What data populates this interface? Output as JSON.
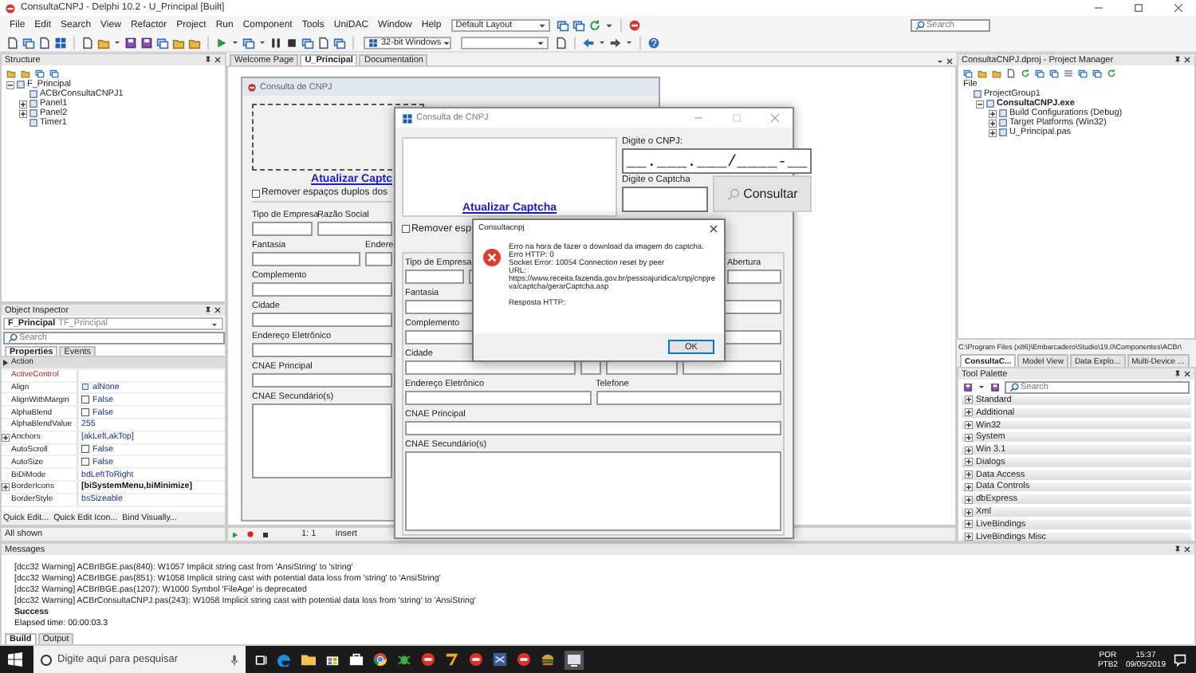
{
  "ide": {
    "title": "ConsultaCNPJ - Delphi 10.2 - U_Principal [Built]",
    "menus": [
      "File",
      "Edit",
      "Search",
      "View",
      "Refactor",
      "Project",
      "Run",
      "Component",
      "Tools",
      "UniDAC",
      "Window",
      "Help"
    ],
    "layout": "Default Layout",
    "search": {
      "placeholder": "Search"
    },
    "platform": "32-bit Windows"
  },
  "structure": {
    "title": "Structure",
    "tree": [
      {
        "label": "F_Principal",
        "expanded": true,
        "children": [
          {
            "label": "ACBrConsultaCNPJ1"
          },
          {
            "label": "Panel1",
            "expanded": false
          },
          {
            "label": "Panel2",
            "expanded": false
          },
          {
            "label": "Timer1"
          }
        ]
      }
    ]
  },
  "object_inspector": {
    "title": "Object Inspector",
    "object": "F_Principal",
    "class": "TF_Principal",
    "search": {
      "placeholder": "Search"
    },
    "tabs": [
      {
        "label": "Properties",
        "selected": true
      },
      {
        "label": "Events",
        "selected": false
      }
    ],
    "properties": [
      {
        "name": "Action",
        "kind": "text",
        "selected": true
      },
      {
        "name": "ActiveControl",
        "kind": "reference",
        "selected": false
      },
      {
        "name": "Align",
        "kind": "enum",
        "value": "alNone",
        "selected": false
      },
      {
        "name": "AlignWithMargin",
        "kind": "bool",
        "checked": false,
        "value": "False",
        "selected": false
      },
      {
        "name": "AlphaBlend",
        "kind": "bool",
        "checked": false,
        "value": "False",
        "selected": false
      },
      {
        "name": "AlphaBlendValue",
        "kind": "text",
        "value": "255",
        "selected": false
      },
      {
        "name": "Anchors",
        "kind": "set",
        "value": "[akLeft,akTop]",
        "selected": false
      },
      {
        "name": "AutoScroll",
        "kind": "bool",
        "checked": false,
        "value": "False",
        "selected": false
      },
      {
        "name": "AutoSize",
        "kind": "bool",
        "checked": false,
        "value": "False",
        "selected": false
      },
      {
        "name": "BiDiMode",
        "kind": "text",
        "value": "bdLeftToRight",
        "selected": false
      },
      {
        "name": "BorderIcons",
        "kind": "set",
        "value": "[biSystemMenu,biMinimize]",
        "selected": false
      },
      {
        "name": "BorderStyle",
        "kind": "text",
        "value": "bsSizeable",
        "selected": false
      }
    ],
    "links": [
      "Quick Edit...",
      "Quick Edit Icon...",
      "Bind Visually..."
    ],
    "filter": "All shown"
  },
  "designer": {
    "tabs": [
      {
        "label": "Welcome Page",
        "selected": false
      },
      {
        "label": "U_Principal",
        "selected": true
      },
      {
        "label": "Documentation",
        "selected": false
      }
    ],
    "form": {
      "title": "Consulta de CNPJ",
      "captcha_link": "Atualizar Captc",
      "trim_option": {
        "label": "Remover espaços duplos dos",
        "checked": false
      },
      "rows": [
        {
          "fields": [
            {
              "kind": "text",
              "label": "Tipo de Empresa"
            },
            {
              "kind": "text",
              "label": "Razão Social"
            }
          ]
        },
        {
          "fields": [
            {
              "kind": "text",
              "label": "Fantasia"
            },
            {
              "kind": "text",
              "label": "Endere"
            }
          ]
        },
        {
          "fields": [
            {
              "kind": "text",
              "label": "Complemento"
            }
          ]
        },
        {
          "fields": [
            {
              "kind": "text",
              "label": "Cidade"
            }
          ]
        },
        {
          "fields": [
            {
              "kind": "text",
              "label": "Endereço Eletrônico"
            }
          ]
        },
        {
          "fields": [
            {
              "kind": "text",
              "label": "CNAE Principal"
            }
          ]
        },
        {
          "fields": [
            {
              "kind": "memo",
              "label": "CNAE Secundário(s)"
            }
          ]
        }
      ]
    },
    "status": {
      "position": "1: 1",
      "mode": "Insert"
    }
  },
  "app_window": {
    "title": "Consulta de CNPJ",
    "cnpj": {
      "label": "Digite o CNPJ:",
      "value": "__.___.___/____-__"
    },
    "captcha": {
      "label": "Digite o Captcha"
    },
    "consult_button": "Consultar",
    "refresh_link": "Atualizar Captcha",
    "trim_option": {
      "label": "Remover esp",
      "checked": false
    },
    "rows": [
      {
        "fields": [
          {
            "kind": "text",
            "label": "Tipo de Empresa"
          },
          {
            "kind": "text"
          },
          {
            "kind": "text",
            "label": "Abertura"
          }
        ]
      },
      {
        "fields": [
          {
            "kind": "text",
            "label": "Fantasia"
          },
          {
            "kind": "text"
          }
        ]
      },
      {
        "fields": [
          {
            "kind": "text",
            "label": "Complemento"
          },
          {
            "kind": "text"
          }
        ]
      },
      {
        "fields": [
          {
            "kind": "text",
            "label": "Cidade"
          },
          {
            "kind": "text"
          },
          {
            "kind": "text"
          },
          {
            "kind": "text"
          }
        ]
      },
      {
        "fields": [
          {
            "kind": "text",
            "label": "Endereço Eletrônico"
          },
          {
            "kind": "text",
            "label": "Telefone"
          }
        ]
      },
      {
        "fields": [
          {
            "kind": "text",
            "label": "CNAE Principal"
          }
        ]
      },
      {
        "fields": [
          {
            "kind": "memo",
            "label": "CNAE Secundário(s)"
          }
        ]
      }
    ]
  },
  "dialog": {
    "title": "Consultacnpj",
    "lines": [
      "Erro na hora de fazer o download da imagem do captcha.",
      "Erro HTTP: 0",
      "Socket Error: 10054 Connection reset by peer",
      "URL:",
      "https://www.receita.fazenda.gov.br/pessoajuridica/cnpj/cnpjreva/captcha/gerarCaptcha.asp",
      "Resposta HTTP:"
    ],
    "ok": "OK"
  },
  "project_manager": {
    "title": "ConsultaCNPJ.dproj - Project Manager",
    "column": "File",
    "tree": [
      {
        "label": "ProjectGroup1",
        "children": [
          {
            "label": "ConsultaCNPJ.exe",
            "active": true,
            "expanded": true,
            "children": [
              {
                "label": "Build Configurations (Debug)",
                "expanded": false
              },
              {
                "label": "Target Platforms (Win32)",
                "expanded": false
              },
              {
                "label": "U_Principal.pas",
                "expanded": false
              }
            ]
          }
        ]
      }
    ],
    "path": "C:\\Program Files (x86)\\Embarcadero\\Studio\\19.0\\Componentes\\ACBr\\",
    "tabs": [
      {
        "label": "ConsultaC...",
        "selected": true
      },
      {
        "label": "Model View",
        "selected": false
      },
      {
        "label": "Data Explo...",
        "selected": false
      },
      {
        "label": "Multi-Device ...",
        "selected": false
      }
    ]
  },
  "tool_palette": {
    "title": "Tool Palette",
    "search": {
      "placeholder": "Search"
    },
    "categories": [
      "Standard",
      "Additional",
      "Win32",
      "System",
      "Win 3.1",
      "Dialogs",
      "Data Access",
      "Data Controls",
      "dbExpress",
      "Xml",
      "LiveBindings",
      "LiveBindings Misc"
    ]
  },
  "messages": {
    "title": "Messages",
    "lines": [
      {
        "kind": "warning",
        "text": "[dcc32 Warning] ACBrIBGE.pas(840): W1057 Implicit string cast from 'AnsiString' to 'string'"
      },
      {
        "kind": "warning",
        "text": "[dcc32 Warning] ACBrIBGE.pas(851): W1058 Implicit string cast with potential data loss from 'string' to 'AnsiString'"
      },
      {
        "kind": "warning",
        "text": "[dcc32 Warning] ACBrIBGE.pas(1207): W1000 Symbol 'FileAge' is deprecated"
      },
      {
        "kind": "warning",
        "text": "[dcc32 Warning] ACBrConsultaCNPJ.pas(243): W1058 Implicit string cast with potential data loss from 'string' to 'AnsiString'"
      },
      {
        "kind": "success",
        "text": "Success"
      },
      {
        "kind": "info",
        "text": "Elapsed time: 00:00:03.3"
      }
    ],
    "tabs": [
      {
        "label": "Build",
        "selected": true
      },
      {
        "label": "Output",
        "selected": false
      }
    ]
  },
  "taskbar": {
    "search": {
      "placeholder": "Digite aqui para pesquisar"
    },
    "language": "POR",
    "keyboard": "PTB2",
    "time": "15:37",
    "date": "09/05/2019"
  }
}
